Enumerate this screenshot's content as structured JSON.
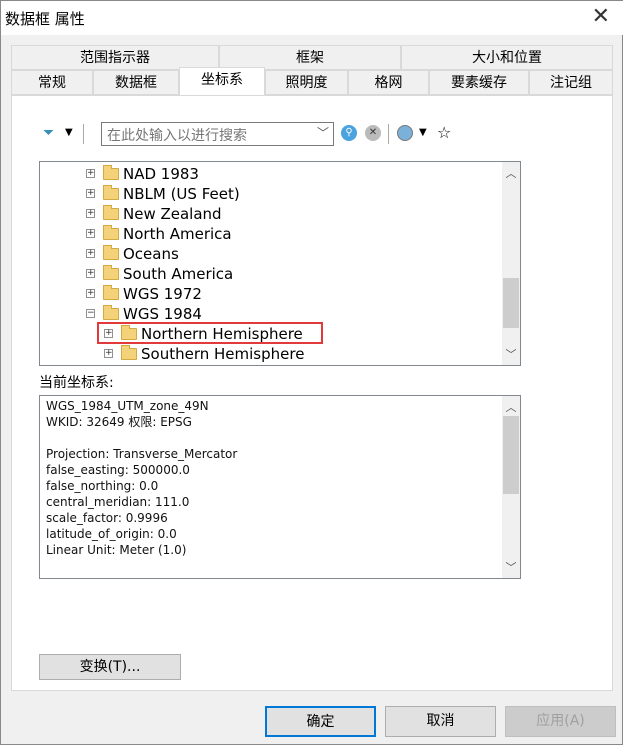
{
  "window": {
    "title": "数据框 属性",
    "close": "✕"
  },
  "tabs_row1": [
    {
      "label": "范围指示器"
    },
    {
      "label": "框架"
    },
    {
      "label": "大小和位置"
    }
  ],
  "tabs_row2": [
    {
      "label": "常规"
    },
    {
      "label": "数据框"
    },
    {
      "label": "坐标系",
      "selected": true
    },
    {
      "label": "照明度"
    },
    {
      "label": "格网"
    },
    {
      "label": "要素缓存"
    },
    {
      "label": "注记组"
    }
  ],
  "toolbar": {
    "search_placeholder": "在此处输入以进行搜索",
    "icons": [
      "filter-icon",
      "search-icon",
      "clear-search-icon",
      "globe-icon",
      "add-favorite-icon"
    ]
  },
  "tree": {
    "items": [
      {
        "label": "NAD 1983",
        "expanded": false
      },
      {
        "label": "NBLM (US Feet)",
        "expanded": false
      },
      {
        "label": "New Zealand",
        "expanded": false
      },
      {
        "label": "North America",
        "expanded": false
      },
      {
        "label": "Oceans",
        "expanded": false
      },
      {
        "label": "South America",
        "expanded": false
      },
      {
        "label": "WGS 1972",
        "expanded": false
      },
      {
        "label": "WGS 1984",
        "expanded": true
      },
      {
        "label": "Northern Hemisphere",
        "expanded": false,
        "highlighted": true,
        "child": true
      },
      {
        "label": "Southern Hemisphere",
        "expanded": false,
        "child": true
      }
    ]
  },
  "current": {
    "label": "当前坐标系:",
    "lines": [
      "WGS_1984_UTM_zone_49N",
      "WKID: 32649 权限: EPSG",
      "",
      "Projection: Transverse_Mercator",
      "false_easting: 500000.0",
      "false_northing: 0.0",
      "central_meridian: 111.0",
      "scale_factor: 0.9996",
      "latitude_of_origin: 0.0",
      "Linear Unit: Meter (1.0)"
    ]
  },
  "buttons": {
    "transform": "变换(T)...",
    "ok": "确定",
    "cancel": "取消",
    "apply": "应用(A)"
  },
  "colors": {
    "highlight_box": "#e23a3a",
    "folder": "#f4d27a"
  }
}
